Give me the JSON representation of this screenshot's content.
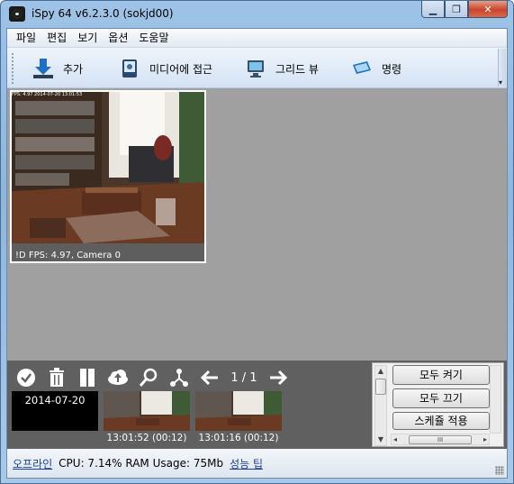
{
  "window": {
    "title": "iSpy 64 v6.2.3.0 (sokjd00)",
    "controls": {
      "minimize": "▁",
      "maximize": "❐",
      "close": "✕"
    }
  },
  "menu": [
    "파일",
    "편집",
    "보기",
    "옵션",
    "도움말"
  ],
  "toolbar": {
    "add_label": "추가",
    "media_label": "미디어에 접근",
    "grid_label": "그리드 뷰",
    "command_label": "명령"
  },
  "camera": {
    "status": "!D  FPS: 4.97, Camera 0",
    "overlay_text": "FPS: 4.97 2014-07-20 13:01:53"
  },
  "bottom": {
    "icons": [
      "check-icon",
      "trash-icon",
      "bookmark-icon",
      "cloud-upload-icon",
      "search-icon",
      "network-icon",
      "arrow-left-icon",
      "arrow-right-icon"
    ],
    "page_indicator": "1 / 1",
    "date_label": "2014-07-20",
    "thumbnails": [
      {
        "caption": "13:01:52 (00:12)"
      },
      {
        "caption": "13:01:16 (00:12)"
      }
    ]
  },
  "right_panel": {
    "all_on": "모두 켜기",
    "all_off": "모두 끄기",
    "apply_schedule": "스케쥴 적용",
    "hscroll_thumb": "III"
  },
  "status": {
    "offline": "오프라인",
    "cpu_ram": "CPU: 7.14% RAM Usage: 75Mb",
    "perf_tip": "성능 팁"
  },
  "colors": {
    "workspace": "#a0a0a0",
    "bottom_panel": "#606060",
    "link": "#1d3f9c"
  }
}
